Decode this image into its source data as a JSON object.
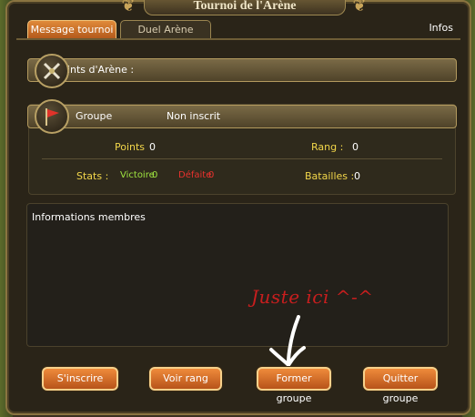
{
  "window": {
    "title": "Tournoi de l'Arène"
  },
  "tabs": [
    {
      "label": "Message tournoi"
    },
    {
      "label": "Duel Arène"
    }
  ],
  "infos_label": "Infos",
  "arena_points": {
    "label": "Points d'Arène :"
  },
  "group": {
    "label": "Groupe",
    "status": "Non inscrit",
    "points_label": "Points",
    "points_value": "0",
    "rank_label": "Rang :",
    "rank_value": "0",
    "stats_label": "Stats :",
    "victories_label": "Victoire",
    "victories_value": "0",
    "defeats_label": "Défaite",
    "defeats_value": "0",
    "battles_label": "Batailles :",
    "battles_value": "0"
  },
  "members": {
    "title": "Informations membres"
  },
  "annotation": {
    "text": "Juste ici ^-^"
  },
  "buttons": {
    "register": "S'inscrire",
    "view_rank": "Voir rang",
    "form_group": "Former groupe",
    "quit_group": "Quitter groupe"
  },
  "colors": {
    "accent_orange": "#d9762c",
    "text_yellow": "#f2d64a",
    "text_green": "#9fe640",
    "text_red": "#e8322e",
    "annotation_red": "#c81e1e"
  },
  "icons": {
    "arena_points": "crossed-swords-icon",
    "group": "red-flag-icon",
    "annotation_arrow": "hand-drawn-arrow-icon"
  }
}
